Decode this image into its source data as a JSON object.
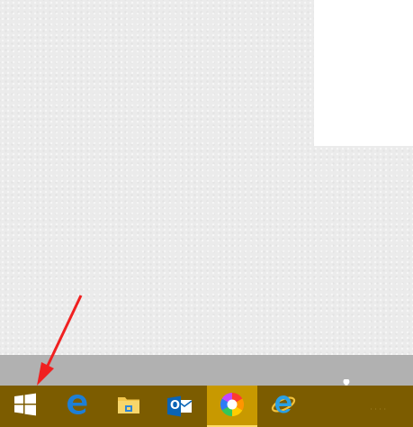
{
  "screen": {
    "accent_color": "#c89900",
    "taskbar_color": "#7c5c00",
    "annotation_color": "#f02020"
  },
  "annotation": {
    "type": "arrow",
    "points_to": "start-button"
  },
  "taskbar": {
    "items": [
      {
        "icon": "windows-start-icon",
        "active": false
      },
      {
        "icon": "edge-icon",
        "active": false
      },
      {
        "icon": "file-explorer-icon",
        "active": false
      },
      {
        "icon": "outlook-icon",
        "active": false,
        "label": "O"
      },
      {
        "icon": "color-wheel-app-icon",
        "active": true
      },
      {
        "icon": "internet-explorer-icon",
        "active": false
      }
    ]
  }
}
